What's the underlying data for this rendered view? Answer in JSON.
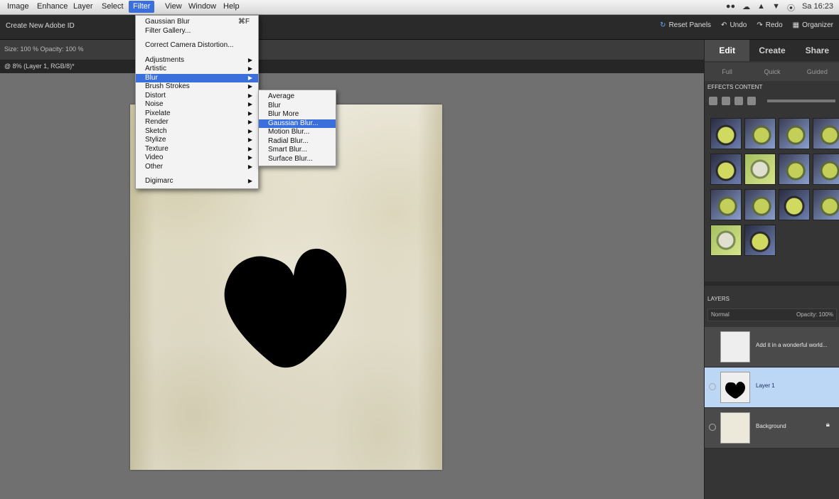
{
  "menubar": {
    "items": [
      "Image",
      "Enhance",
      "Layer",
      "Select",
      "Filter",
      "View",
      "Window",
      "Help"
    ],
    "active": "Filter",
    "status": [
      "●●",
      "☁",
      "▲",
      "▼",
      "⦿",
      "Sa 16:23"
    ]
  },
  "appbar": {
    "title": "Create New Adobe ID",
    "actions": {
      "reset": "Reset Panels",
      "undo": "Undo",
      "redo": "Redo",
      "organizer": "Organizer"
    }
  },
  "optbar": {
    "text": "Size: 100 %   Opacity: 100 %"
  },
  "document": {
    "tab": "@ 8% (Layer 1, RGB/8)*"
  },
  "filter_menu": {
    "items": [
      {
        "label": "Gaussian Blur",
        "shortcut": "⌘F",
        "sub": false
      },
      {
        "label": "Filter Gallery...",
        "shortcut": "",
        "sub": false
      },
      {
        "sep": true
      },
      {
        "label": "Correct Camera Distortion...",
        "shortcut": "",
        "sub": false
      },
      {
        "sep": true
      },
      {
        "label": "Adjustments",
        "sub": true
      },
      {
        "label": "Artistic",
        "sub": true
      },
      {
        "label": "Blur",
        "sub": true,
        "highlighted": true
      },
      {
        "label": "Brush Strokes",
        "sub": true
      },
      {
        "label": "Distort",
        "sub": true
      },
      {
        "label": "Noise",
        "sub": true
      },
      {
        "label": "Pixelate",
        "sub": true
      },
      {
        "label": "Render",
        "sub": true
      },
      {
        "label": "Sketch",
        "sub": true
      },
      {
        "label": "Stylize",
        "sub": true
      },
      {
        "label": "Texture",
        "sub": true
      },
      {
        "label": "Video",
        "sub": true
      },
      {
        "label": "Other",
        "sub": true
      },
      {
        "sep": true
      },
      {
        "label": "Digimarc",
        "sub": true
      }
    ]
  },
  "blur_submenu": {
    "items": [
      {
        "label": "Average"
      },
      {
        "label": "Blur"
      },
      {
        "label": "Blur More"
      },
      {
        "label": "Gaussian Blur...",
        "highlighted": true
      },
      {
        "label": "Motion Blur..."
      },
      {
        "label": "Radial Blur..."
      },
      {
        "label": "Smart Blur..."
      },
      {
        "label": "Surface Blur..."
      }
    ]
  },
  "panel": {
    "tabs": [
      "Edit",
      "Create",
      "Share"
    ],
    "active_tab": "Edit",
    "subtabs": [
      "Full",
      "Quick",
      "Guided"
    ],
    "effects_head": "EFFECTS   CONTENT",
    "layers_head": "LAYERS",
    "blend_mode": "Normal",
    "opacity": "Opacity: 100%",
    "layers": [
      {
        "name": "Add it in a wonderful world...",
        "selected": false,
        "locked": false
      },
      {
        "name": "Layer 1",
        "selected": true,
        "locked": false
      },
      {
        "name": "Background",
        "selected": false,
        "locked": true
      }
    ]
  },
  "colors": {
    "menu_highlight": "#3b6fdc",
    "layer_selected": "#bcd6f5",
    "paper": "#ece8da"
  }
}
